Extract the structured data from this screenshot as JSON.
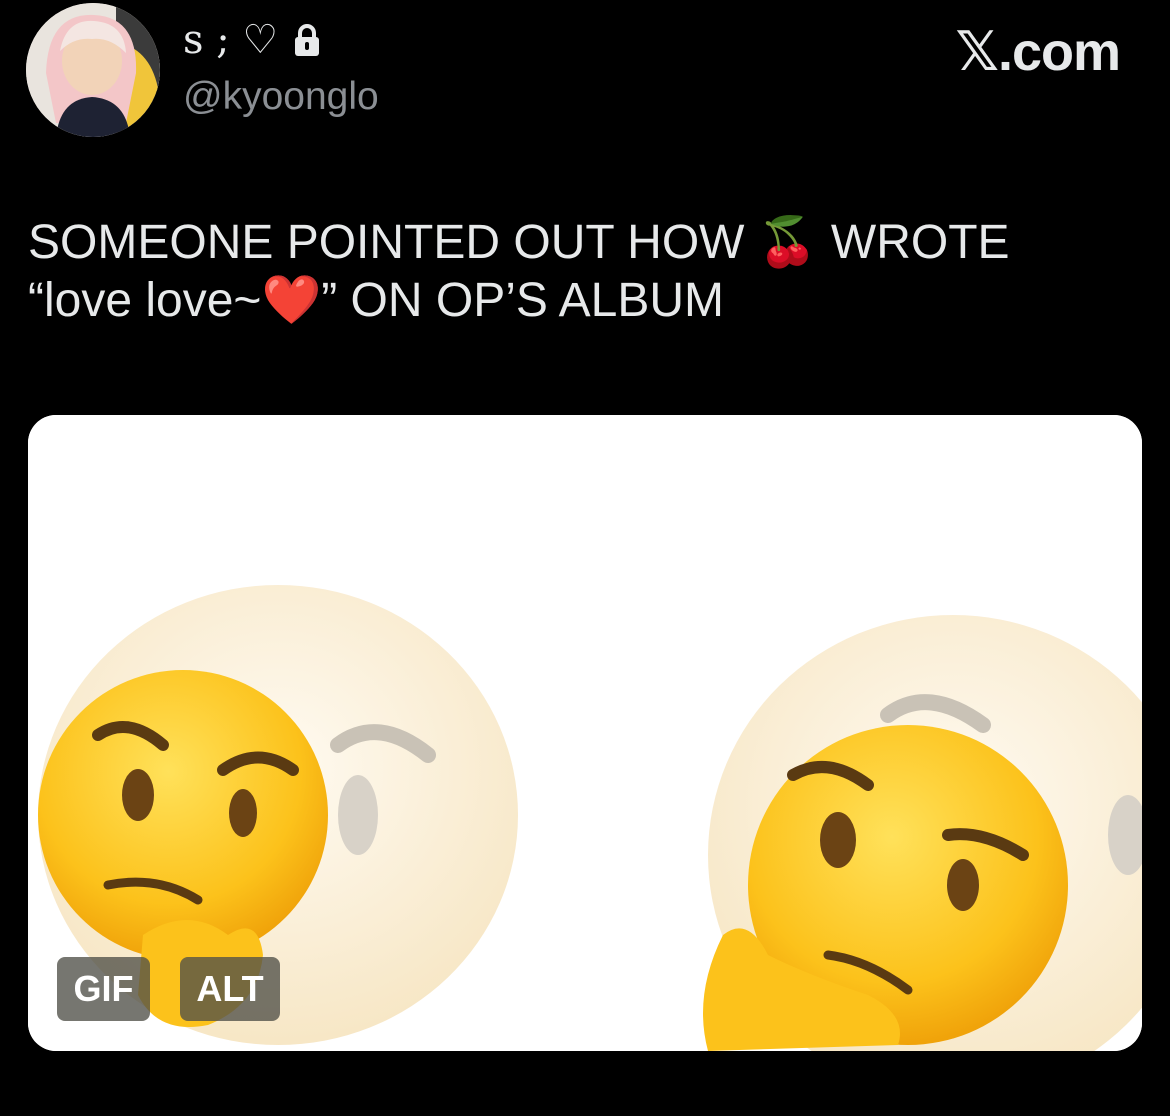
{
  "author": {
    "display_name": "s ; ♡",
    "handle": "@kyoonglo",
    "avatar_icon": "profile-photo"
  },
  "brand": "𝕏.com",
  "tweet": {
    "line1": "SOMEONE POINTED OUT HOW 🍒 WROTE",
    "line2": "“love love~❤️” ON OP’S ALBUM"
  },
  "media": {
    "type": "GIF",
    "gif_label": "GIF",
    "alt_label": "ALT",
    "content_icon": "thinking-face-emoji"
  },
  "colors": {
    "background": "#000000",
    "text": "#e7e9ea",
    "handle": "#8b8f94",
    "badge_bg": "#505048"
  }
}
